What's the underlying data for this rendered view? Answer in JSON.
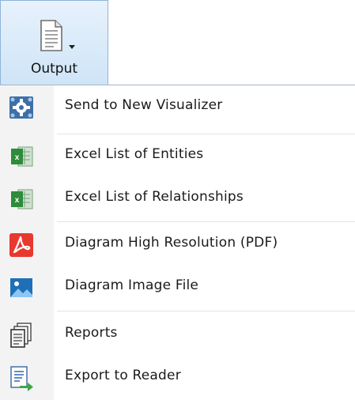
{
  "ribbon": {
    "output_label": "Output",
    "output_icon": "document-icon",
    "dropdown_icon": "chevron-down-icon",
    "colors": {
      "ribbon_fill": "#cfe4f7",
      "ribbon_border": "#8fb4d8"
    }
  },
  "menu": {
    "items": [
      {
        "label": "Send to New Visualizer",
        "icon": "visualizer-icon"
      },
      {
        "label": "Excel List of Entities",
        "icon": "excel-icon"
      },
      {
        "label": "Excel List of Relationships",
        "icon": "excel-icon"
      },
      {
        "label": "Diagram High Resolution (PDF)",
        "icon": "pdf-icon"
      },
      {
        "label": "Diagram Image File",
        "icon": "image-icon"
      },
      {
        "label": "Reports",
        "icon": "reports-icon"
      },
      {
        "label": "Export to Reader",
        "icon": "export-icon"
      }
    ]
  }
}
